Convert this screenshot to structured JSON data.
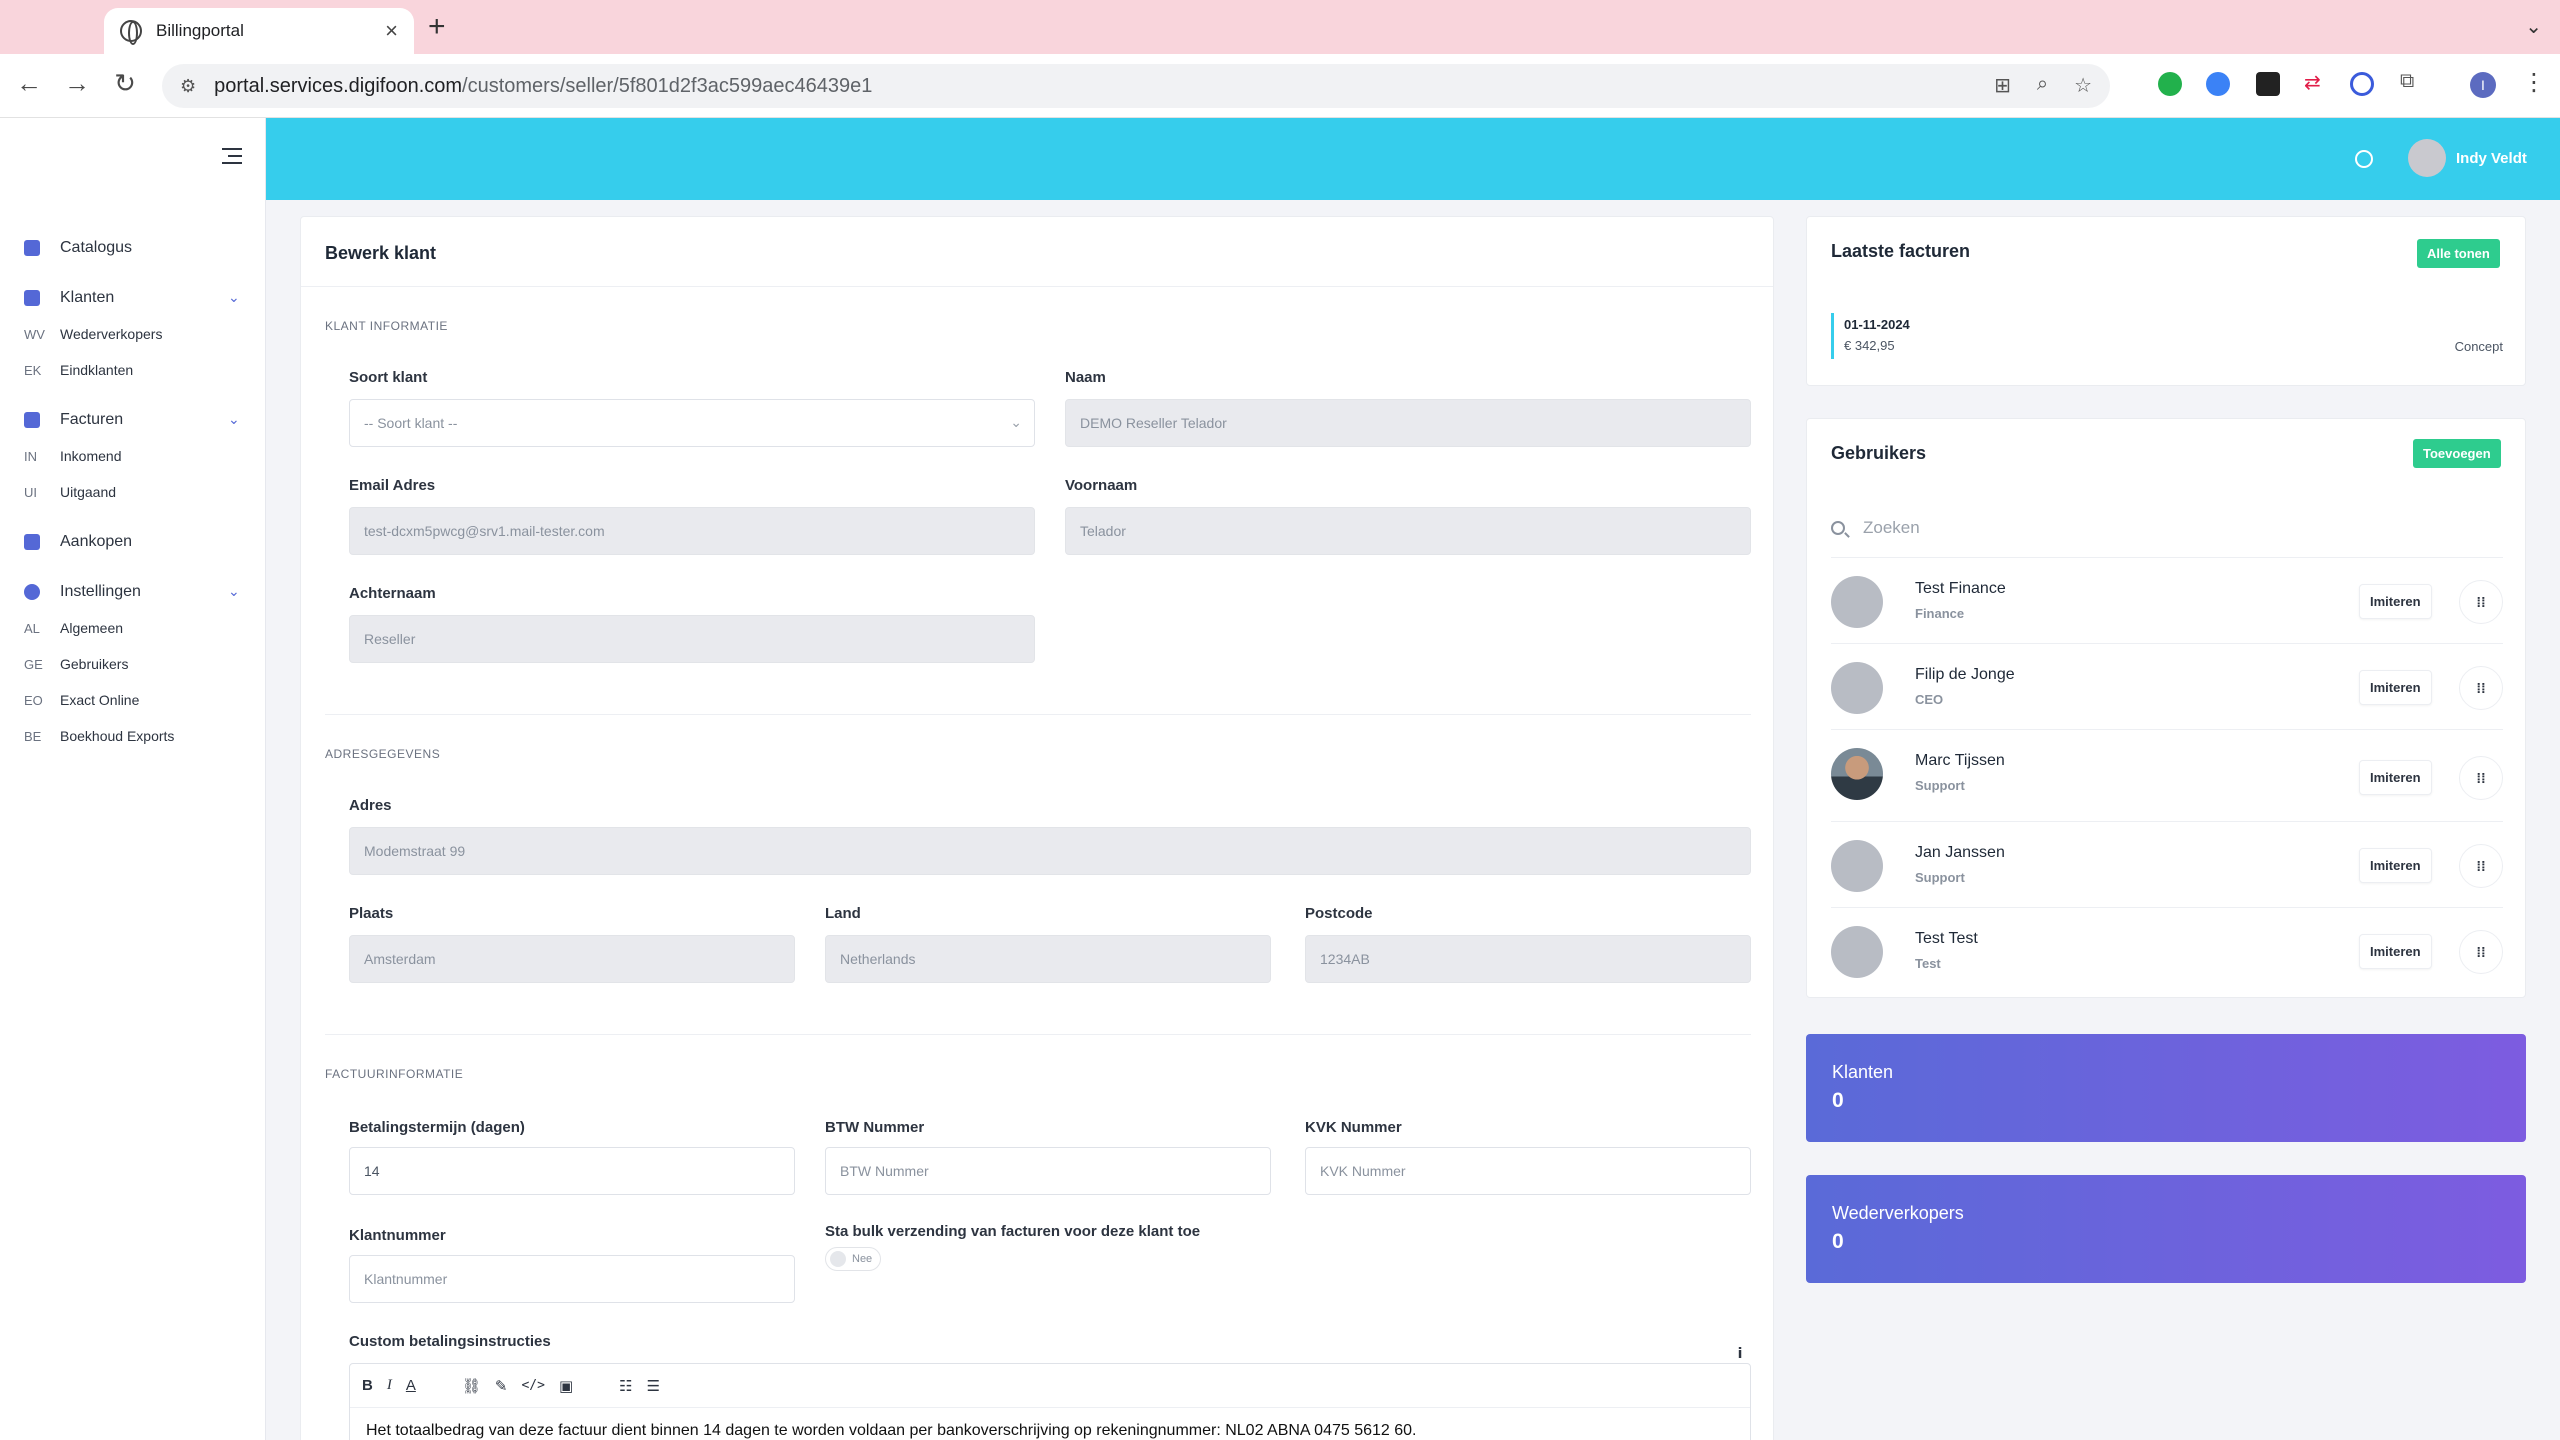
{
  "browser": {
    "tab_title": "Billingportal",
    "url_host": "portal.services.digifoon.com",
    "url_path": "/customers/seller/5f801d2f3ac599aec46439e1",
    "profile_initial": "I"
  },
  "header": {
    "user_name": "Indy Veldt"
  },
  "sidebar": {
    "items": [
      {
        "label": "Catalogus"
      },
      {
        "label": "Klanten",
        "children": [
          {
            "abbr": "WV",
            "label": "Wederverkopers"
          },
          {
            "abbr": "EK",
            "label": "Eindklanten"
          }
        ]
      },
      {
        "label": "Facturen",
        "children": [
          {
            "abbr": "IN",
            "label": "Inkomend"
          },
          {
            "abbr": "UI",
            "label": "Uitgaand"
          }
        ]
      },
      {
        "label": "Aankopen"
      },
      {
        "label": "Instellingen",
        "children": [
          {
            "abbr": "AL",
            "label": "Algemeen"
          },
          {
            "abbr": "GE",
            "label": "Gebruikers"
          },
          {
            "abbr": "EO",
            "label": "Exact Online"
          },
          {
            "abbr": "BE",
            "label": "Boekhoud Exports"
          }
        ]
      }
    ]
  },
  "form": {
    "title": "Bewerk klant",
    "sections": {
      "klant": "KLANT INFORMATIE",
      "adres": "ADRESGEGEVENS",
      "factuur": "FACTUURINFORMATIE"
    },
    "soort_klant": {
      "label": "Soort klant",
      "value": "-- Soort klant --"
    },
    "naam": {
      "label": "Naam",
      "value": "DEMO Reseller Telador"
    },
    "email": {
      "label": "Email Adres",
      "value": "test-dcxm5pwcg@srv1.mail-tester.com"
    },
    "voornaam": {
      "label": "Voornaam",
      "value": "Telador"
    },
    "achternaam": {
      "label": "Achternaam",
      "value": "Reseller"
    },
    "adres": {
      "label": "Adres",
      "value": "Modemstraat 99"
    },
    "plaats": {
      "label": "Plaats",
      "value": "Amsterdam"
    },
    "land": {
      "label": "Land",
      "value": "Netherlands"
    },
    "postcode": {
      "label": "Postcode",
      "value": "1234AB"
    },
    "betalingstermijn": {
      "label": "Betalingstermijn (dagen)",
      "value": "14"
    },
    "btw": {
      "label": "BTW Nummer",
      "placeholder": "BTW Nummer"
    },
    "kvk": {
      "label": "KVK Nummer",
      "placeholder": "KVK Nummer"
    },
    "klantnummer": {
      "label": "Klantnummer",
      "placeholder": "Klantnummer"
    },
    "bulk": {
      "label": "Sta bulk verzending van facturen voor deze klant toe",
      "toggle_text": "Nee"
    },
    "custom": {
      "label": "Custom betalingsinstructies",
      "text": "Het totaalbedrag van deze factuur dient binnen 14 dagen te worden voldaan per bankoverschrijving op rekeningnummer: NL02 ABNA 0475 5612 60."
    }
  },
  "invoices": {
    "title": "Laatste facturen",
    "button": "Alle tonen",
    "items": [
      {
        "date": "01-11-2024",
        "amount": "€ 342,95",
        "status": "Concept"
      }
    ]
  },
  "users": {
    "title": "Gebruikers",
    "button": "Toevoegen",
    "search_placeholder": "Zoeken",
    "impersonate_label": "Imiteren",
    "items": [
      {
        "name": "Test Finance",
        "role": "Finance"
      },
      {
        "name": "Filip de Jonge",
        "role": "CEO"
      },
      {
        "name": "Marc Tijssen",
        "role": "Support"
      },
      {
        "name": "Jan Janssen",
        "role": "Support"
      },
      {
        "name": "Test Test",
        "role": "Test"
      }
    ]
  },
  "stats": {
    "klanten": {
      "label": "Klanten",
      "value": "0"
    },
    "wederverkopers": {
      "label": "Wederverkopers",
      "value": "0"
    }
  },
  "colors": {
    "accent": "#36cdec",
    "primary": "#5468d6",
    "success": "#2ecc8e"
  }
}
